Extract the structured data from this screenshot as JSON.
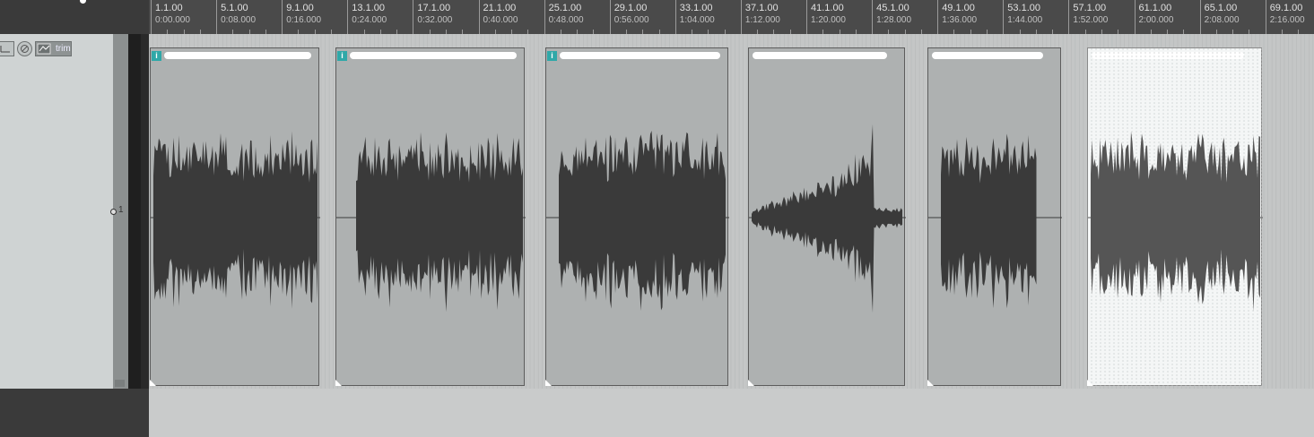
{
  "header": {
    "title": ""
  },
  "track": {
    "number": "1",
    "automation_label": "trim",
    "controls": [
      {
        "name": "envelope-icon"
      },
      {
        "name": "power-icon"
      },
      {
        "name": "pan-icon"
      }
    ]
  },
  "ruler": {
    "marks": [
      {
        "bar": "1.1.00",
        "time": "0:00.000"
      },
      {
        "bar": "5.1.00",
        "time": "0:08.000"
      },
      {
        "bar": "9.1.00",
        "time": "0:16.000"
      },
      {
        "bar": "13.1.00",
        "time": "0:24.000"
      },
      {
        "bar": "17.1.00",
        "time": "0:32.000"
      },
      {
        "bar": "21.1.00",
        "time": "0:40.000"
      },
      {
        "bar": "25.1.00",
        "time": "0:48.000"
      },
      {
        "bar": "29.1.00",
        "time": "0:56.000"
      },
      {
        "bar": "33.1.00",
        "time": "1:04.000"
      },
      {
        "bar": "37.1.00",
        "time": "1:12.000"
      },
      {
        "bar": "41.1.00",
        "time": "1:20.000"
      },
      {
        "bar": "45.1.00",
        "time": "1:28.000"
      },
      {
        "bar": "49.1.00",
        "time": "1:36.000"
      },
      {
        "bar": "53.1.00",
        "time": "1:44.000"
      },
      {
        "bar": "57.1.00",
        "time": "1:52.000"
      },
      {
        "bar": "61.1.00",
        "time": "2:00.000"
      },
      {
        "bar": "65.1.00",
        "time": "2:08.000"
      },
      {
        "bar": "69.1.00",
        "time": "2:16.000"
      }
    ]
  },
  "items": [
    {
      "badge": "i",
      "selected": false,
      "shape": "even"
    },
    {
      "badge": "i",
      "selected": false,
      "shape": "even"
    },
    {
      "badge": "i",
      "selected": false,
      "shape": "even"
    },
    {
      "badge": "",
      "selected": false,
      "shape": "ramp"
    },
    {
      "badge": "",
      "selected": false,
      "shape": "short"
    },
    {
      "badge": "",
      "selected": true,
      "shape": "even"
    }
  ],
  "colors": {
    "accent": "#2fa8a8",
    "waveform": "#3a3a3a",
    "waveform_selected": "#555555",
    "item_bg": "#aeb1b1",
    "arrange_bg": "#c4c6c6"
  }
}
